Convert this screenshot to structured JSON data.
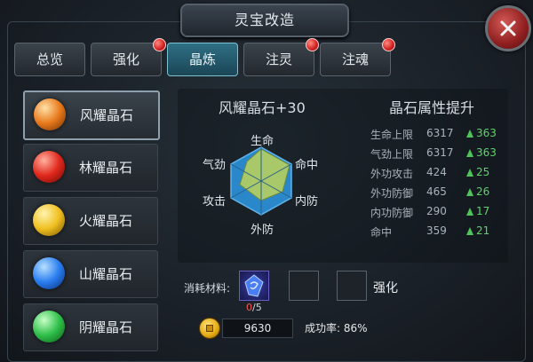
{
  "window": {
    "title": "灵宝改造"
  },
  "tabs": [
    {
      "label": "总览",
      "active": false,
      "alert": false
    },
    {
      "label": "强化",
      "active": false,
      "alert": true
    },
    {
      "label": "晶炼",
      "active": true,
      "alert": false
    },
    {
      "label": "注灵",
      "active": false,
      "alert": true
    },
    {
      "label": "注魂",
      "active": false,
      "alert": true
    }
  ],
  "gems": [
    {
      "name": "风耀晶石",
      "color": "#e87a1c",
      "selected": true
    },
    {
      "name": "林耀晶石",
      "color": "#e0281c",
      "selected": false
    },
    {
      "name": "火耀晶石",
      "color": "#f0c020",
      "selected": false
    },
    {
      "name": "山耀晶石",
      "color": "#2a7ef0",
      "selected": false
    },
    {
      "name": "阴耀晶石",
      "color": "#2fc04a",
      "selected": false
    }
  ],
  "detail": {
    "stone_name": "风耀晶石+30",
    "attr_title": "晶石属性提升",
    "radar_labels": {
      "top": "生命",
      "top_right": "命中",
      "right": "内防",
      "bottom": "外防",
      "left": "攻击",
      "top_left": "气劲"
    },
    "radar_colors": {
      "hex": "#2a87c9",
      "fill": "#a8c86a"
    },
    "stats": [
      {
        "name": "生命上限",
        "value": "6317",
        "increase": "363"
      },
      {
        "name": "气劲上限",
        "value": "6317",
        "increase": "363"
      },
      {
        "name": "外功攻击",
        "value": "424",
        "increase": "25"
      },
      {
        "name": "外功防御",
        "value": "465",
        "increase": "26"
      },
      {
        "name": "内功防御",
        "value": "290",
        "increase": "17"
      },
      {
        "name": "命中",
        "value": "359",
        "increase": "21"
      }
    ]
  },
  "cost": {
    "label": "消耗材料:",
    "count_current": "0",
    "count_total": "/5",
    "enhance_label": "强化",
    "gold": "9630",
    "success_rate": "成功率: 86%"
  }
}
